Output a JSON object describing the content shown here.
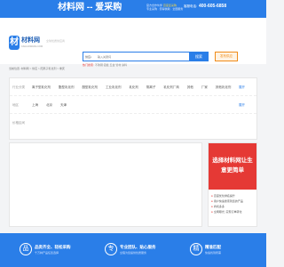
{
  "topbar": {
    "brand": "材料网 -- 爱采购",
    "tagline_prefix": "官方合作伙伴",
    "tagline_accent": "百度爱采购",
    "tagline_sub": "专业采购 · 值得信赖 · 全国服务",
    "phone_label": "客服电话:",
    "phone": "400-605-6858"
  },
  "header": {
    "logo_mark": "材",
    "logo_text": "材料网",
    "logo_sub": "CAILIAOWANG.COM",
    "slogan": "全球优质供应商",
    "search_category": "供应",
    "search_placeholder": "输入关键词",
    "search_button": "搜索",
    "post_button": "发布供应",
    "hot_label": "热门搜索:",
    "hot_items": "不锈钢 铝板 五金 管材 涂料"
  },
  "breadcrumb": "当前位置: 材料网 > 供应 > 阳离子乳化剂 > 重庆",
  "filters": {
    "row1_label": "行业分类",
    "row1_options": [
      "离子型乳化剂",
      "酯型乳化剂",
      "醚型乳化剂",
      "工业乳化剂",
      "乳化剂",
      "阴离子",
      "乳化剂厂商",
      "其他",
      "厂家",
      "其他乳化剂",
      "阴离子乳化剂"
    ],
    "row2_label": "地区",
    "row2_options": [
      "上海",
      "北京",
      "天津"
    ],
    "row3_label": "价格区间",
    "expand": "展开"
  },
  "ad": {
    "line1": "选择材料网让生",
    "line2": "意更简单",
    "points": [
      "百度优化排名提升",
      "用户快速搜索到您的产品",
      "商机多多",
      "全网曝光, 实现订单转化"
    ]
  },
  "footer": {
    "features": [
      {
        "icon": "品",
        "title": "品类齐全、轻松采购",
        "sub": "千万种产品任您选择"
      },
      {
        "icon": "专",
        "title": "专业团队、贴心服务",
        "sub": "全程为您提供优质服务"
      },
      {
        "icon": "精",
        "title": "精准匹配",
        "sub": "快速找到所需"
      }
    ]
  },
  "colors": {
    "brand_blue": "#2a7ee8",
    "ad_red": "#e53935",
    "post_orange": "#f08c1a"
  }
}
